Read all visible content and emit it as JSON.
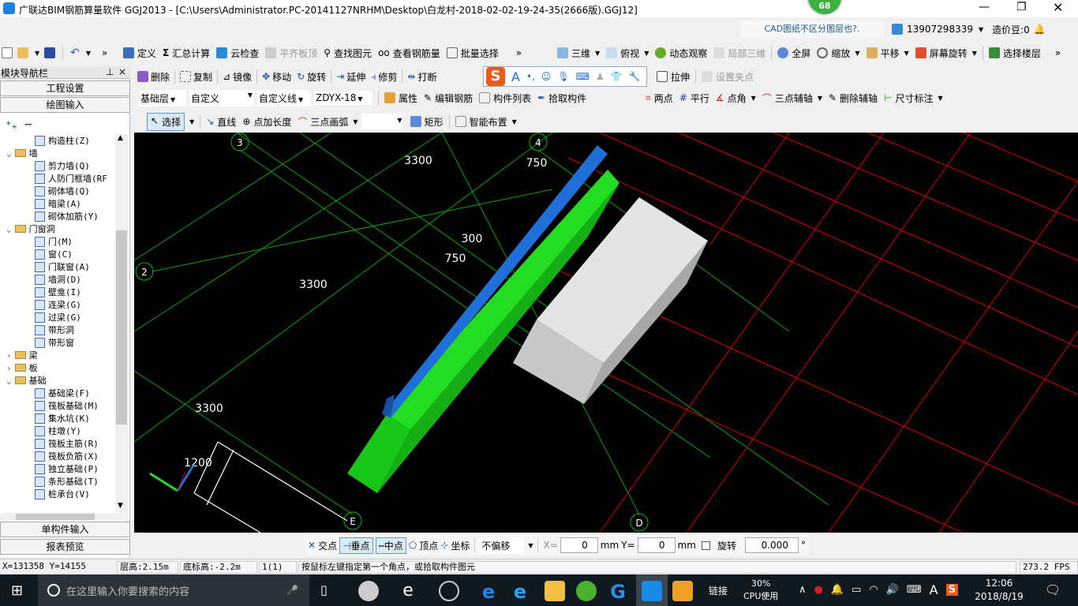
{
  "title": "广联达BIM钢筋算量软件 GGJ2013 - [C:\\Users\\Administrator.PC-20141127NRHM\\Desktop\\白龙村-2018-02-02-19-24-35(2666版).GGJ12]",
  "badge": "68",
  "info": {
    "cad_tip": "CAD图纸不区分图层也?.",
    "user": "13907298339",
    "beans": "造价豆:0"
  },
  "toolbar1": [
    "定义",
    "汇总计算",
    "云检查",
    "平齐板顶",
    "查找图元",
    "查看钢筋量",
    "批量选择"
  ],
  "toolbar1_right": [
    "三维",
    "俯视",
    "动态观察",
    "局部三维",
    "全屏",
    "缩放",
    "平移",
    "屏幕旋转",
    "选择楼层"
  ],
  "toolbar2": [
    "删除",
    "复制",
    "镜像",
    "移动",
    "旋转",
    "延伸",
    "修剪",
    "打断"
  ],
  "toolbar2_right": [
    "拉伸",
    "设置夹点"
  ],
  "toolbar3": {
    "floor": "基础层",
    "type": "自定义",
    "sub": "自定义线",
    "name": "ZDYX-18",
    "buttons": [
      "属性",
      "编辑钢筋",
      "构件列表",
      "拾取构件"
    ]
  },
  "toolbar3_right": [
    "两点",
    "平行",
    "点角",
    "三点辅轴",
    "删除辅轴",
    "尺寸标注"
  ],
  "toolbar4": [
    "选择",
    "直线",
    "点加长度",
    "三点画弧",
    "矩形",
    "智能布置"
  ],
  "sidebar": {
    "title": "模块导航栏",
    "buttons": [
      "工程设置",
      "绘图输入"
    ],
    "bottom": [
      "单构件输入",
      "报表预览"
    ],
    "tree": [
      {
        "label": "构造柱(Z)",
        "level": 2
      },
      {
        "label": "墙",
        "level": 1,
        "open": true
      },
      {
        "label": "剪力墙(Q)",
        "level": 2
      },
      {
        "label": "人防门框墙(RF",
        "level": 2
      },
      {
        "label": "砌体墙(Q)",
        "level": 2
      },
      {
        "label": "暗梁(A)",
        "level": 2
      },
      {
        "label": "砌体加筋(Y)",
        "level": 2
      },
      {
        "label": "门窗洞",
        "level": 1,
        "open": true
      },
      {
        "label": "门(M)",
        "level": 2
      },
      {
        "label": "窗(C)",
        "level": 2
      },
      {
        "label": "门联窗(A)",
        "level": 2
      },
      {
        "label": "墙洞(D)",
        "level": 2
      },
      {
        "label": "壁龛(I)",
        "level": 2
      },
      {
        "label": "连梁(G)",
        "level": 2
      },
      {
        "label": "过梁(G)",
        "level": 2
      },
      {
        "label": "带形洞",
        "level": 2
      },
      {
        "label": "带形窗",
        "level": 2
      },
      {
        "label": "梁",
        "level": 1,
        "open": false
      },
      {
        "label": "板",
        "level": 1,
        "open": false
      },
      {
        "label": "基础",
        "level": 1,
        "open": true
      },
      {
        "label": "基础梁(F)",
        "level": 2
      },
      {
        "label": "筏板基础(M)",
        "level": 2
      },
      {
        "label": "集水坑(K)",
        "level": 2
      },
      {
        "label": "柱墩(Y)",
        "level": 2
      },
      {
        "label": "筏板主筋(R)",
        "level": 2
      },
      {
        "label": "筏板负筋(X)",
        "level": 2
      },
      {
        "label": "独立基础(P)",
        "level": 2
      },
      {
        "label": "条形基础(T)",
        "level": 2
      },
      {
        "label": "桩承台(V)",
        "level": 2
      }
    ]
  },
  "viewport": {
    "axes": [
      "3",
      "4",
      "2",
      "E",
      "D"
    ],
    "dims": [
      "3300",
      "750",
      "300",
      "750",
      "3300",
      "3300",
      "1200"
    ]
  },
  "snap": {
    "buttons": [
      "交点",
      "垂点",
      "中点",
      "顶点",
      "坐标"
    ],
    "offset": "不偏移",
    "x_label": "X=",
    "x": "0",
    "y_label": "Y=",
    "y": "0",
    "unit": "mm",
    "rotate_label": "旋转",
    "rotate": "0.000",
    "deg": "°"
  },
  "status": {
    "coords": "X=131358 Y=14155",
    "floor_h": "层高:2.15m",
    "base_h": "底标高:-2.2m",
    "count": "1(1)",
    "hint": "按鼠标左键指定第一个角点，或拾取构件图元",
    "fps": "273.2 FPS"
  },
  "taskbar": {
    "search": "在这里输入你要搜索的内容",
    "link": "链接",
    "cpu": "30%",
    "cpu_label": "CPU使用",
    "time": "12:06",
    "date": "2018/8/19",
    "ime": "A"
  },
  "colors": {
    "viewport": "#000000",
    "grid": "#00c000",
    "axis_red": "#e00000",
    "beam_blue": "#1e6fd8",
    "beam_green": "#22dd22",
    "box": "#e4e4e4"
  }
}
